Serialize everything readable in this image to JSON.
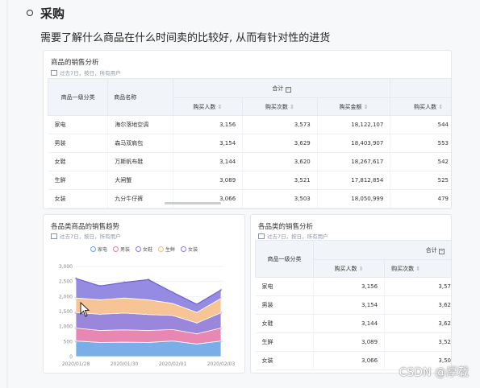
{
  "doc": {
    "heading": "采购",
    "paragraph": "需要了解什么商品在什么时间卖的比较好, 从而有针对性的进货"
  },
  "top_table": {
    "title": "商品的销售分析",
    "subtitle": "过去7日，按日，所有用户",
    "col_cat": "商品一级分类",
    "col_name": "商品名称",
    "group_label": "合计",
    "columns": [
      "购买人数",
      "购买次数",
      "购买金额",
      "购买人数"
    ],
    "rows": [
      {
        "cat": "家电",
        "name": "海尔落地空调",
        "v1": "3,156",
        "v2": "3,573",
        "v3": "18,122,107",
        "v4": "544"
      },
      {
        "cat": "男装",
        "name": "森马双肩包",
        "v1": "3,154",
        "v2": "3,629",
        "v3": "18,403,907",
        "v4": "553"
      },
      {
        "cat": "女鞋",
        "name": "万斯帆布鞋",
        "v1": "3,144",
        "v2": "3,620",
        "v3": "18,267,617",
        "v4": "542"
      },
      {
        "cat": "生鲜",
        "name": "大闸蟹",
        "v1": "3,089",
        "v2": "3,521",
        "v3": "17,812,854",
        "v4": "525"
      },
      {
        "cat": "女装",
        "name": "九分牛仔裤",
        "v1": "3,066",
        "v2": "3,503",
        "v3": "18,050,999",
        "v4": "479"
      }
    ]
  },
  "trend": {
    "title": "各品类商品的销售趋势",
    "subtitle": "过去7日，按日，所有用户"
  },
  "chart_data": {
    "type": "area",
    "stacked": true,
    "x": [
      "2020/01/28",
      "2020/01/29",
      "2020/01/30",
      "2020/01/31",
      "2020/02/01",
      "2020/02/02",
      "2020/02/03"
    ],
    "x_tick_labels": [
      "2020/01/28",
      "2020/01/30",
      "2020/02/01",
      "2020/02/03"
    ],
    "y_ticks": [
      "0",
      "500",
      "1,000",
      "1,500",
      "2,000",
      "2,500",
      "3,000"
    ],
    "ylim": [
      0,
      3000
    ],
    "legend_position": "top",
    "series": [
      {
        "name": "家电",
        "color": "#6aa5e6",
        "values": [
          520,
          470,
          480,
          470,
          520,
          420,
          520
        ]
      },
      {
        "name": "男装",
        "color": "#e67aa8",
        "values": [
          430,
          400,
          410,
          400,
          380,
          340,
          430
        ]
      },
      {
        "name": "女鞋",
        "color": "#8f7ad8",
        "values": [
          520,
          540,
          560,
          530,
          470,
          360,
          510
        ]
      },
      {
        "name": "生鲜",
        "color": "#f5be8a",
        "values": [
          480,
          480,
          500,
          490,
          400,
          350,
          480
        ]
      },
      {
        "name": "女装",
        "color": "#8a7ee0",
        "values": [
          650,
          460,
          520,
          670,
          370,
          270,
          280
        ]
      }
    ]
  },
  "bottom_table": {
    "title": "各品类的销售分析",
    "subtitle": "过去7日，按日，所有用户",
    "col_cat": "商品一级分类",
    "group_label": "合计",
    "columns": [
      "购买人数",
      "购买次数"
    ],
    "rows": [
      {
        "cat": "家电",
        "v1": "3,156",
        "v2": "3,57"
      },
      {
        "cat": "男装",
        "v1": "3,154",
        "v2": "3,62"
      },
      {
        "cat": "女鞋",
        "v1": "3,144",
        "v2": "3,62"
      },
      {
        "cat": "生鲜",
        "v1": "3,089",
        "v2": "3,52"
      },
      {
        "cat": "女装",
        "v1": "3,066",
        "v2": "3,50"
      }
    ]
  },
  "watermark": "CSDN @厚载"
}
